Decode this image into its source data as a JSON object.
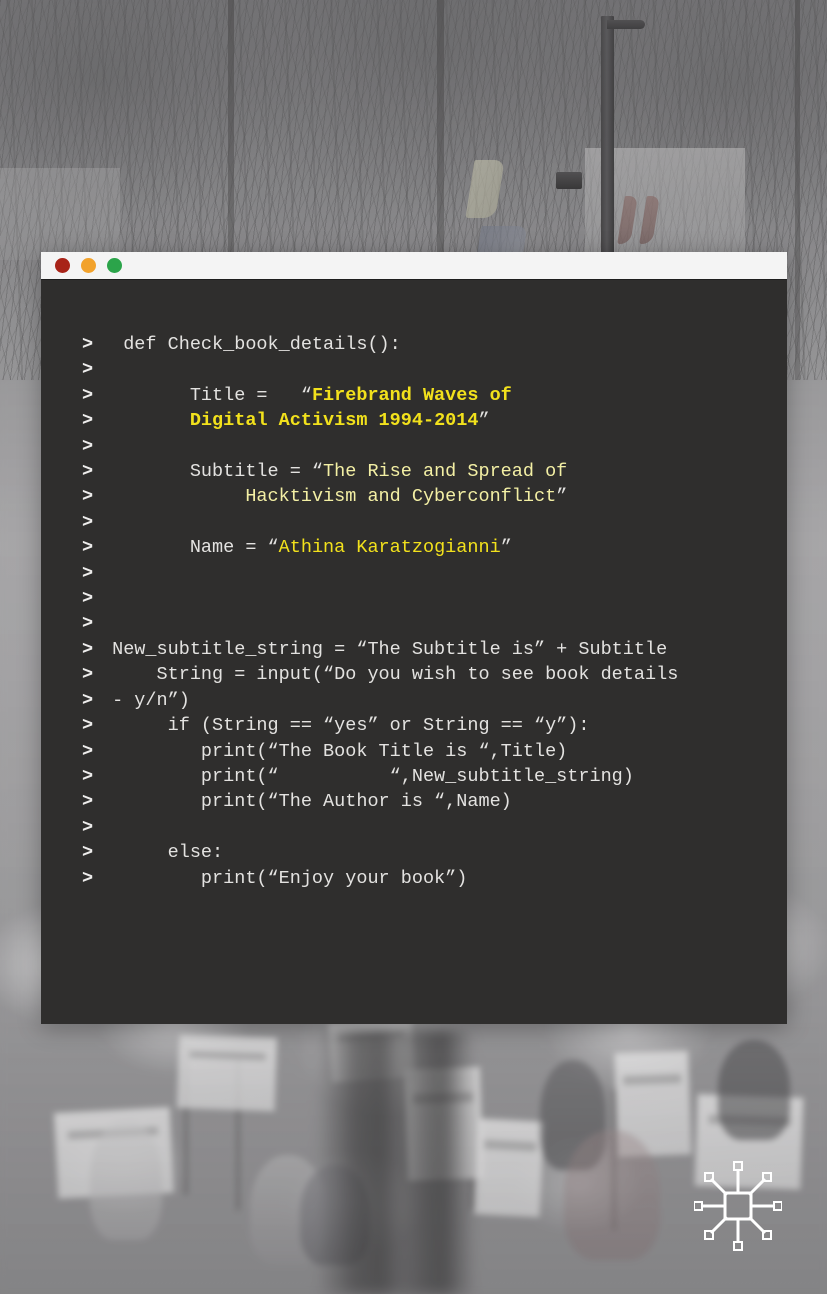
{
  "book": {
    "title": "Firebrand Waves of Digital Activism 1994-2014",
    "subtitle": "The Rise and Spread of Hacktivism and Cyberconflict",
    "author": "Athina Karatzogianni",
    "publisher_logo_name": "palgrave-macmillan-logo"
  },
  "window": {
    "controls": [
      {
        "name": "close-button",
        "label": "Close",
        "color": "#a82318"
      },
      {
        "name": "minimize-button",
        "label": "Minimize",
        "color": "#f2a22b"
      },
      {
        "name": "maximize-button",
        "label": "Maximize",
        "color": "#2ba44a"
      }
    ],
    "titlebar_color": "#f4f4f4",
    "screen_color": "#2f2e2d"
  },
  "terminal": {
    "prompt_symbol": ">",
    "text_color": "#e3e2e0",
    "accent_title_color": "#f2e11c",
    "accent_subtitle_color": "#f3efa4",
    "lines": [
      {
        "prompt": ">",
        "segments": [
          {
            "text": "  def Check_book_details():",
            "style": "plain"
          }
        ]
      },
      {
        "prompt": ">",
        "segments": [
          {
            "text": "",
            "style": "plain"
          }
        ]
      },
      {
        "prompt": ">",
        "segments": [
          {
            "text": "        Title =   “",
            "style": "plain"
          },
          {
            "text": "Firebrand Waves of",
            "style": "title"
          }
        ]
      },
      {
        "prompt": ">",
        "segments": [
          {
            "text": "        ",
            "style": "plain"
          },
          {
            "text": "Digital Activism 1994-2014",
            "style": "title"
          },
          {
            "text": "”",
            "style": "plain"
          }
        ]
      },
      {
        "prompt": ">",
        "segments": [
          {
            "text": "",
            "style": "plain"
          }
        ]
      },
      {
        "prompt": ">",
        "segments": [
          {
            "text": "        Subtitle = “",
            "style": "plain"
          },
          {
            "text": "The Rise and Spread of",
            "style": "subtitle"
          }
        ]
      },
      {
        "prompt": ">",
        "segments": [
          {
            "text": "             ",
            "style": "plain"
          },
          {
            "text": "Hacktivism and Cyberconflict",
            "style": "subtitle"
          },
          {
            "text": "”",
            "style": "plain"
          }
        ]
      },
      {
        "prompt": ">",
        "segments": [
          {
            "text": "",
            "style": "plain"
          }
        ]
      },
      {
        "prompt": ">",
        "segments": [
          {
            "text": "        Name = “",
            "style": "plain"
          },
          {
            "text": "Athina Karatzogianni",
            "style": "name"
          },
          {
            "text": "”",
            "style": "plain"
          }
        ]
      },
      {
        "prompt": ">",
        "segments": [
          {
            "text": "",
            "style": "plain"
          }
        ]
      },
      {
        "prompt": ">",
        "segments": [
          {
            "text": "",
            "style": "plain"
          }
        ]
      },
      {
        "prompt": ">",
        "segments": [
          {
            "text": "",
            "style": "plain"
          }
        ]
      },
      {
        "prompt": ">",
        "segments": [
          {
            "text": " New_subtitle_string = “The Subtitle is” + Subtitle",
            "style": "plain"
          }
        ]
      },
      {
        "prompt": ">",
        "segments": [
          {
            "text": "     String = input(“Do you wish to see book details",
            "style": "plain"
          }
        ]
      },
      {
        "prompt": ">",
        "segments": [
          {
            "text": " - y/n”)",
            "style": "plain"
          }
        ]
      },
      {
        "prompt": ">",
        "segments": [
          {
            "text": "      if (String == “yes” or String == “y”):",
            "style": "plain"
          }
        ]
      },
      {
        "prompt": ">",
        "segments": [
          {
            "text": "         print(“The Book Title is “,Title)",
            "style": "plain"
          }
        ]
      },
      {
        "prompt": ">",
        "segments": [
          {
            "text": "         print(“          “,New_subtitle_string)",
            "style": "plain"
          }
        ]
      },
      {
        "prompt": ">",
        "segments": [
          {
            "text": "         print(“The Author is “,Name)",
            "style": "plain"
          }
        ]
      },
      {
        "prompt": ">",
        "segments": [
          {
            "text": "",
            "style": "plain"
          }
        ]
      },
      {
        "prompt": ">",
        "segments": [
          {
            "text": "      else:",
            "style": "plain"
          }
        ]
      },
      {
        "prompt": ">",
        "segments": [
          {
            "text": "         print(“Enjoy your book”)",
            "style": "plain"
          }
        ]
      }
    ]
  }
}
